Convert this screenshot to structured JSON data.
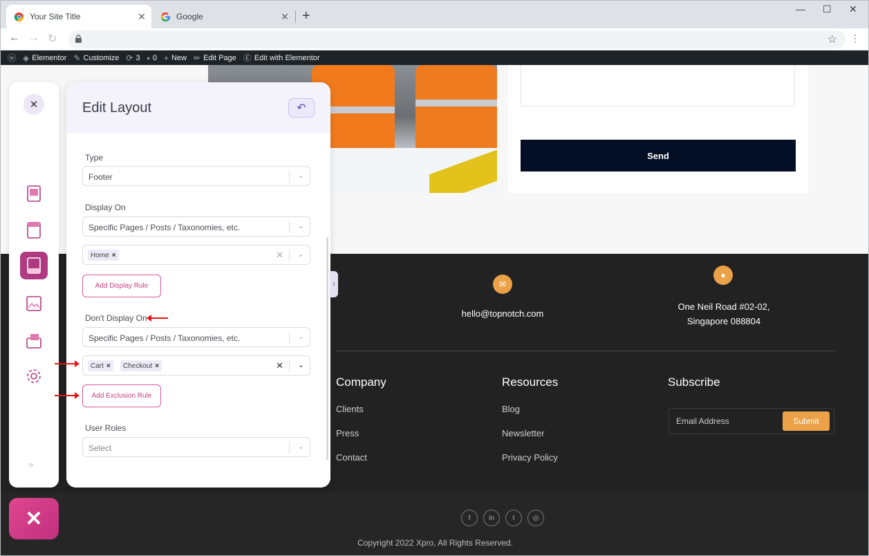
{
  "browser": {
    "tabs": [
      {
        "title": "Your Site Title",
        "active": true
      },
      {
        "title": "Google",
        "active": false
      }
    ],
    "new_tab": "+",
    "window": {
      "minimize": "—",
      "maximize": "☐",
      "close": "✕"
    }
  },
  "wp_admin_bar": {
    "items": [
      {
        "icon": "wordpress-icon",
        "label": ""
      },
      {
        "icon": "elementor-icon",
        "label": "Elementor"
      },
      {
        "icon": "brush-icon",
        "label": "Customize"
      },
      {
        "icon": "update-icon",
        "label": "3"
      },
      {
        "icon": "comment-icon",
        "label": "0"
      },
      {
        "icon": "plus-icon",
        "label": "New"
      },
      {
        "icon": "pencil-icon",
        "label": "Edit Page"
      },
      {
        "icon": "elementor-e-icon",
        "label": "Edit with Elementor"
      }
    ]
  },
  "site": {
    "form": {
      "send_label": "Send"
    },
    "footer": {
      "email": "hello@topnotch.com",
      "address_line1": "One Neil Road #02-02,",
      "address_line2": "Singapore 088804",
      "columns": [
        {
          "heading": "Company",
          "links": [
            "Clients",
            "Press",
            "Contact"
          ]
        },
        {
          "heading": "Resources",
          "links": [
            "Blog",
            "Newsletter",
            "Privacy Policy"
          ]
        }
      ],
      "subscribe": {
        "heading": "Subscribe",
        "placeholder": "Email Address",
        "button": "Submit"
      },
      "social": [
        "facebook-icon",
        "linkedin-icon",
        "twitter-icon",
        "instagram-icon"
      ],
      "copyright": "Copyright 2022 Xpro, All Rights Reserved."
    }
  },
  "panel": {
    "title": "Edit Layout",
    "type": {
      "label": "Type",
      "value": "Footer"
    },
    "display_on": {
      "label": "Display On",
      "value": "Specific Pages / Posts / Taxonomies, etc.",
      "chips": [
        "Home"
      ],
      "add_button": "Add Display Rule"
    },
    "dont_display_on": {
      "label": "Don't Display On",
      "value": "Specific Pages / Posts / Taxonomies, etc.",
      "chips": [
        "Cart",
        "Checkout"
      ],
      "add_button": "Add Exclusion Rule"
    },
    "user_roles": {
      "label": "User Roles",
      "placeholder": "Select"
    }
  },
  "colors": {
    "accent": "#c4407f",
    "footer_bg": "#222222",
    "button_dark": "#040e24",
    "footer_icon": "#eaa147"
  }
}
